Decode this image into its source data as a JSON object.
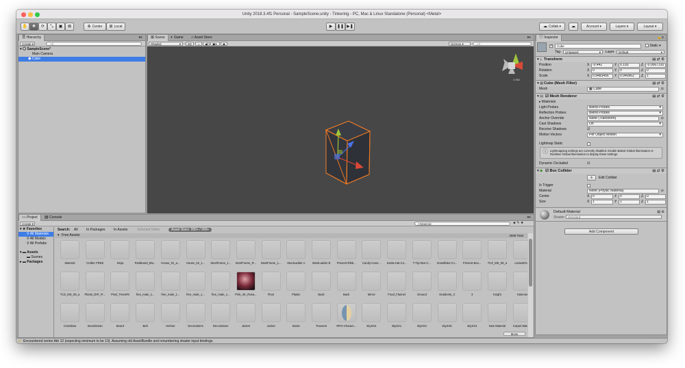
{
  "window": {
    "title": "Unity 2018.3.4f1 Personal - SampleScene.unity - Tinkering - PC, Mac & Linux Standalone (Personal) <Metal>"
  },
  "toolbar": {
    "center": "Center",
    "local": "Local",
    "collab": "Collab",
    "account": "Account",
    "layers": "Layers",
    "layout": "Layout"
  },
  "hierarchy": {
    "tab": "Hierarchy",
    "create": "Create",
    "search_placeholder": "All",
    "scene": "SampleScene*",
    "items": [
      "Main Camera",
      "Cube"
    ]
  },
  "scene_tabs": [
    "Scene",
    "Game",
    "Asset Store"
  ],
  "scene_bar": {
    "shading": "Shaded",
    "mode2d": "2D",
    "gizmos": "Gizmos",
    "search_placeholder": "All"
  },
  "scene_view": {
    "persp": "≡ Iso"
  },
  "inspector": {
    "tab": "Inspector",
    "name": "Cube",
    "static": "Static",
    "tag_label": "Tag",
    "tag": "Untagged",
    "layer_label": "Layer",
    "layer": "Default",
    "transform": {
      "title": "Transform",
      "position_label": "Position",
      "rotation_label": "Rotation",
      "scale_label": "Scale",
      "position": [
        "-0.442",
        "0.193",
        "-0.0067310"
      ],
      "rotation": [
        "0",
        "0",
        "0"
      ],
      "scale": [
        "0.9483456",
        "0.940962",
        "1"
      ]
    },
    "mesh_filter": {
      "title": "Cube (Mesh Filter)",
      "mesh_label": "Mesh",
      "mesh": "Cube"
    },
    "mesh_renderer": {
      "title": "Mesh Renderer",
      "materials": "Materials",
      "rows": [
        {
          "k": "Light Probes",
          "v": "Blend Probes"
        },
        {
          "k": "Reflection Probes",
          "v": "Blend Probes"
        },
        {
          "k": "Anchor Override",
          "v": "None (Transform)"
        },
        {
          "k": "Cast Shadows",
          "v": "On"
        },
        {
          "k": "Receive Shadows",
          "v": ""
        },
        {
          "k": "Motion Vectors",
          "v": "Per Object Motion"
        }
      ],
      "lightmap_static": "Lightmap Static",
      "info": "Lightmapping settings are currently disabled. Enable Baked Global Illumination or Realtime Global Illumination to display these settings.",
      "dynamic_occluded": "Dynamic Occluded"
    },
    "box_collider": {
      "title": "Box Collider",
      "edit": "Edit Collider",
      "is_trigger": "Is Trigger",
      "material_label": "Material",
      "material": "None (Physic Material)",
      "center_label": "Center",
      "center": [
        "0",
        "0",
        "0"
      ],
      "size_label": "Size",
      "size": [
        "1",
        "1",
        "1"
      ]
    },
    "material": {
      "name": "Default-Material",
      "shader_label": "Shader",
      "shader": "Standard"
    },
    "add_component": "Add Component"
  },
  "project": {
    "tabs": [
      "Project",
      "Console"
    ],
    "create": "Create",
    "search_placeholder": "t:Material",
    "favorites": "Favorites",
    "fav_items": [
      "All Materials",
      "All Models",
      "All Prefabs"
    ],
    "assets": "Assets",
    "asset_items": [
      "Scenes"
    ],
    "packages": "Packages",
    "filter": {
      "search": "Search:",
      "all": "All",
      "in_packages": "In Packages",
      "in_assets": "In Assets",
      "selected": "Selected folder",
      "store": "Asset Store: 999+ / 999+"
    },
    "group": "Free Assets",
    "count": "2699 Total",
    "rows": [
      [
        "Material",
        "Crafter FREE",
        "Ninja",
        "RedBoard_Blu...",
        "House_01_a...",
        "House_02_1...",
        "SteelFrame_1...",
        "SteelFrame_R...",
        "SteelFrame_1...",
        "SteelLadder A",
        "SteelLadder B",
        "Present-Ribb...",
        "Candy-Cane...",
        "Santa-Hat-Co...",
        "T-Tip-Star-C...",
        "Snowflake-Co...",
        "Present-Box...",
        "TCZ_MS_09_a",
        "cactusEGov"
      ],
      [
        "TCZ_MS_09_a",
        "Plants_DIP_Fr...",
        "Pixel_Trees#9",
        "free_male_1...",
        "free_male_1...",
        "free_male_1...",
        "free_male_1...",
        "Pink_4K_Rosa...",
        "Floor",
        "Plastic",
        "Back",
        "Back",
        "Mirror",
        "Food_Flannel",
        "Ground",
        "Gradients_3",
        "3",
        "Knight",
        "Hammer"
      ],
      [
        "Crossbow",
        "Swordsman",
        "Beard",
        "Belt",
        "Helmet",
        "Decorations",
        "Decorations",
        "Jacket",
        "Jacket",
        "Boots",
        "Trousers",
        "RPG-Charact...",
        "skySX4",
        "skySX1",
        "skySX3",
        "skySX5",
        "skySX2",
        "New Material",
        "Carpet Mater..."
      ]
    ],
    "footer": "Moss"
  },
  "status": {
    "message": "Encountered vertex Attr 12 (expecting minimum to be 13). Assuming old AssetBundle and renumbering shader input bindings."
  }
}
